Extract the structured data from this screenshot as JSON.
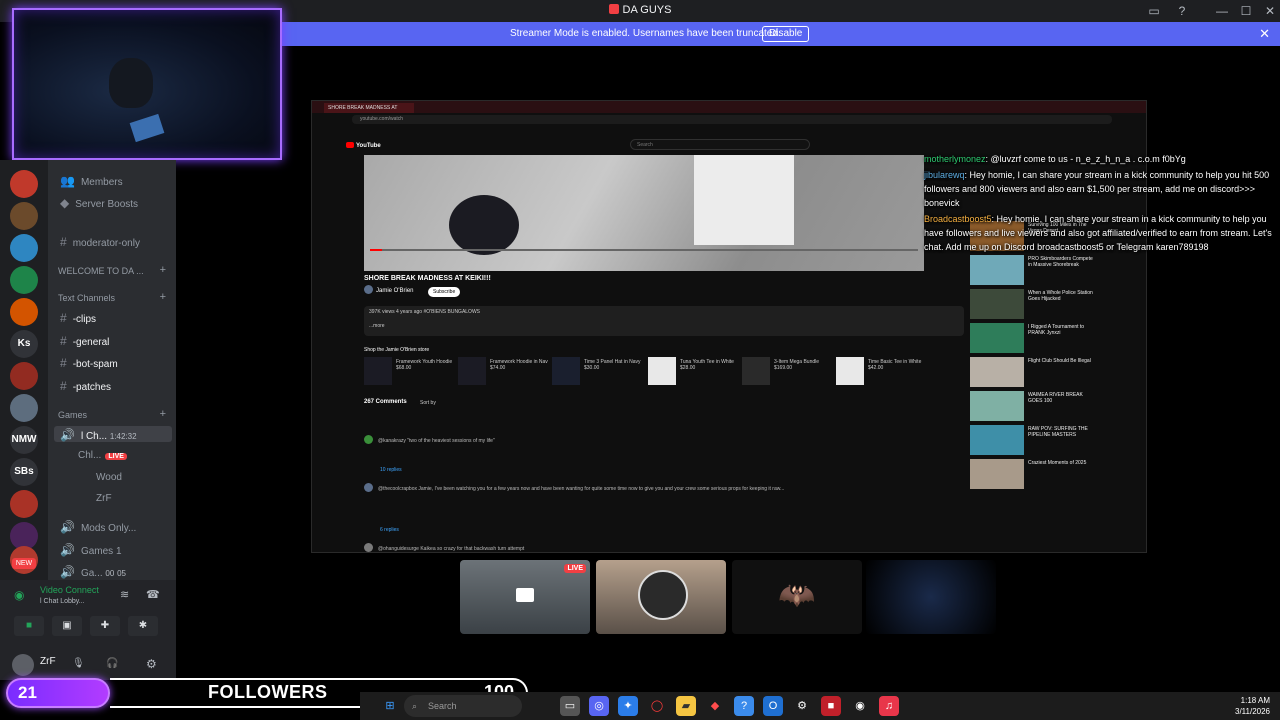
{
  "window": {
    "title": "DA GUYS"
  },
  "banner": {
    "message": "Streamer Mode is enabled. Usernames have been truncated.",
    "disable_label": "Disable"
  },
  "servers": [
    {
      "label": "",
      "color": "#c0392b"
    },
    {
      "label": "",
      "color": "#6b4a2b"
    },
    {
      "label": "",
      "color": "#2e86c1"
    },
    {
      "label": "",
      "color": "#1e8449"
    },
    {
      "label": "",
      "color": "#d35400"
    },
    {
      "label": "Ks",
      "color": "#313338"
    },
    {
      "label": "",
      "color": "#922b21"
    },
    {
      "label": "",
      "color": "#5d6d7e"
    },
    {
      "label": "NMW",
      "color": "#313338"
    },
    {
      "label": "SBs",
      "color": "#313338"
    },
    {
      "label": "",
      "color": "#a93226"
    },
    {
      "label": "",
      "color": "#4a235a"
    },
    {
      "label": "",
      "color": "#b03a2e"
    }
  ],
  "rail_new": "NEW",
  "sidebar": {
    "members": "Members",
    "server_boosts": "Server Boosts",
    "moderator_only": "moderator-only",
    "welcome": "WELCOME TO DA ...",
    "text_channels": "Text Channels",
    "channels": [
      "-clips",
      "-general",
      "-bot-spam",
      "-patches"
    ],
    "games": "Games",
    "voice": [
      {
        "name": "l Ch...",
        "time": "1:42:32"
      },
      {
        "name": "Chl...",
        "badge": "LIVE"
      },
      {
        "name": "Wood"
      },
      {
        "name": "ZrF"
      },
      {
        "name": "Mods Only..."
      },
      {
        "name": "Games 1"
      },
      {
        "name": "Ga...",
        "a": "00",
        "b": "05"
      }
    ]
  },
  "voice_panel": {
    "title": "Video Connect",
    "subtitle": "l Chat Lobby...",
    "user": "ZrF"
  },
  "browser": {
    "tab_label": "SHORE BREAK MADNESS AT",
    "url": "youtube.com/watch",
    "search_placeholder": "Search",
    "yt_logo": "YouTube",
    "video_title": "SHORE BREAK MADNESS AT KEIKI!!!",
    "channel": "Jamie O'Brien",
    "subscribe": "Subscribe",
    "desc_line1": "397K views  4 years ago  #O'BIENS BUNGALOWS",
    "desc_line2": "...more",
    "shop_title": "Shop the Jamie O'Brien store",
    "shop_items": [
      {
        "name": "Framework Youth Hoodie",
        "price": "$68.00"
      },
      {
        "name": "Framework Hoodie in Nav",
        "price": "$74.00"
      },
      {
        "name": "Time 3 Panel Hat in Navy",
        "price": "$30.00"
      },
      {
        "name": "Tuna Youth Tee in White",
        "price": "$28.00"
      },
      {
        "name": "3-Item Mega Bundle",
        "price": "$169.00"
      },
      {
        "name": "Time Basic Tee in White",
        "price": "$42.00"
      }
    ],
    "comments_count": "267 Comments",
    "sort_by": "Sort by",
    "comments": [
      {
        "text": "@kanakrazy  \"two of the heaviest sessions of my life\""
      },
      {
        "text": "10 replies"
      },
      {
        "text": "@thecoolcrapbox  Jamie, I've been watching you for a few years now and have been wanting for quite some time now to give you and your crew some serious props for keeping it raw..."
      },
      {
        "text": "6 replies"
      },
      {
        "text": "@ohanguidesurge  Kaikea so crazy for that backwash turn attempt"
      }
    ],
    "recommended": [
      "Surviving 100 Miles in The Vegas Desert",
      "PRO Skimboarders Compete in Massive Shorebreak",
      "When a Whole Police Station Goes Hijacked",
      "I Rigged A Tournament to PRANK Jynxzi",
      "Flight Club Should Be Illegal",
      "WAIMEA RIVER BREAK GOES 100",
      "RAW POV: SURFING THE PIPELINE MASTERS",
      "Craziest Moments of 2025"
    ]
  },
  "chat": [
    {
      "user": "motherlymonez",
      "text": ": @luvzrf come to us - n_e_z_h_n_a . c.o.m f0bYg"
    },
    {
      "user": "jibularewq",
      "text": ": Hey homie, I can share your stream in a kick community to help you hit 500 followers and 800 viewers and also earn $1,500 per stream, add me on discord>>> bonevick"
    },
    {
      "user": "Broadcastboost5",
      "text": ": Hey homie, I can share your stream in a kick community to help you have followers and live viewers and also got affiliated/verified to earn from stream. Let's chat. Add me up on Discord broadcastboost5 or Telegram karen789198"
    }
  ],
  "tiles": {
    "live_label": "LIVE"
  },
  "followers": {
    "count": "21",
    "label": "FOLLOWERS",
    "goal": "100"
  },
  "taskbar": {
    "search": "Search",
    "time": "1:18 AM",
    "date": "3/11/2026"
  },
  "colors": {
    "accent": "#5865f2",
    "live": "#f23f43",
    "overlay": "#a86cff"
  }
}
